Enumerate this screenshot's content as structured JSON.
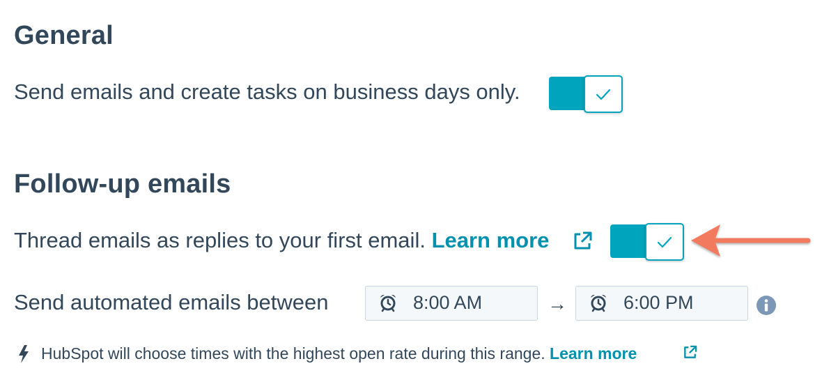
{
  "general": {
    "heading": "General",
    "business_days_label": "Send emails and create tasks on business days only.",
    "business_days_toggle": true
  },
  "followup": {
    "heading": "Follow-up emails",
    "thread_label": "Thread emails as replies to your first email.",
    "thread_learn_more": "Learn more",
    "thread_toggle": true,
    "send_between_label": "Send automated emails between",
    "start_time": "8:00 AM",
    "arrow": "→",
    "end_time": "6:00 PM",
    "hint_text": "HubSpot will choose times with the highest open rate during this range.",
    "hint_learn_more": "Learn more"
  },
  "colors": {
    "accent": "#00a4bd",
    "link": "#0091ae",
    "text": "#33475b",
    "annotation_arrow": "#f27a5e",
    "info_icon": "#7c98b6"
  },
  "icons": {
    "check": "check-icon",
    "external_link": "external-link-icon",
    "alarm_clock": "alarm-clock-icon",
    "arrow_right": "arrow-right-icon",
    "info": "info-icon",
    "lightning": "lightning-icon",
    "annotation_arrow": "annotation-arrow-icon"
  }
}
